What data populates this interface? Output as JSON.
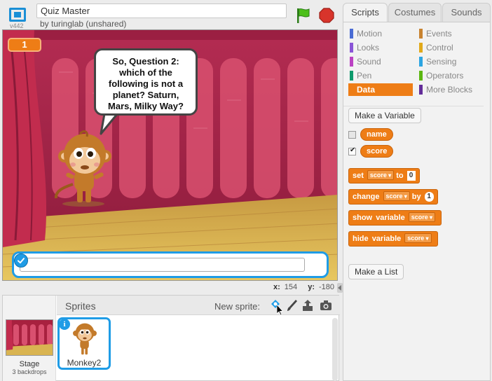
{
  "header": {
    "version": "v442",
    "project_title": "Quiz Master",
    "byline": "by turinglab (unshared)"
  },
  "stage": {
    "variable_monitor": "1",
    "speech_text": "So, Question 2: which of the following is not a planet? Saturn, Mars, Milky Way?",
    "answer_value": ""
  },
  "coords": {
    "x_label": "x:",
    "x_value": "154",
    "y_label": "y:",
    "y_value": "-180"
  },
  "sprites": {
    "title": "Sprites",
    "new_sprite_label": "New sprite:",
    "stage_label": "Stage",
    "backdrops_label": "3 backdrops",
    "selected_sprite": "Monkey2",
    "info_label": "i"
  },
  "tabs": [
    {
      "label": "Scripts",
      "active": true
    },
    {
      "label": "Costumes",
      "active": false
    },
    {
      "label": "Sounds",
      "active": false
    }
  ],
  "categories": [
    {
      "label": "Motion",
      "color": "#4a6cd4"
    },
    {
      "label": "Events",
      "color": "#c88330"
    },
    {
      "label": "Looks",
      "color": "#8a55d7"
    },
    {
      "label": "Control",
      "color": "#e1a91a"
    },
    {
      "label": "Sound",
      "color": "#bb42c3"
    },
    {
      "label": "Sensing",
      "color": "#2ca5e2"
    },
    {
      "label": "Pen",
      "color": "#0e9a6c"
    },
    {
      "label": "Operators",
      "color": "#5cb712"
    },
    {
      "label": "Data",
      "color": "#ee7d16",
      "active": true
    },
    {
      "label": "More Blocks",
      "color": "#632d99"
    }
  ],
  "palette": {
    "make_variable": "Make a Variable",
    "variables": [
      {
        "name": "name",
        "checked": false
      },
      {
        "name": "score",
        "checked": true
      }
    ],
    "blocks": {
      "set": {
        "word1": "set",
        "var": "score",
        "word2": "to",
        "value": "0"
      },
      "change": {
        "word1": "change",
        "var": "score",
        "word2": "by",
        "value": "1"
      },
      "show": {
        "word1": "show",
        "word2": "variable",
        "var": "score"
      },
      "hide": {
        "word1": "hide",
        "word2": "variable",
        "var": "score"
      }
    },
    "make_list": "Make a List"
  },
  "colors": {
    "accent_blue": "#1f9ce6",
    "data_orange": "#ee7d16",
    "curtain_red": "#b0264a",
    "floor_yellow": "#d9b451"
  },
  "icons": [
    "fullscreen-icon",
    "green-flag-icon",
    "stop-icon",
    "choose-sprite-icon",
    "paint-icon",
    "upload-icon",
    "camera-icon",
    "check-icon",
    "info-icon"
  ]
}
